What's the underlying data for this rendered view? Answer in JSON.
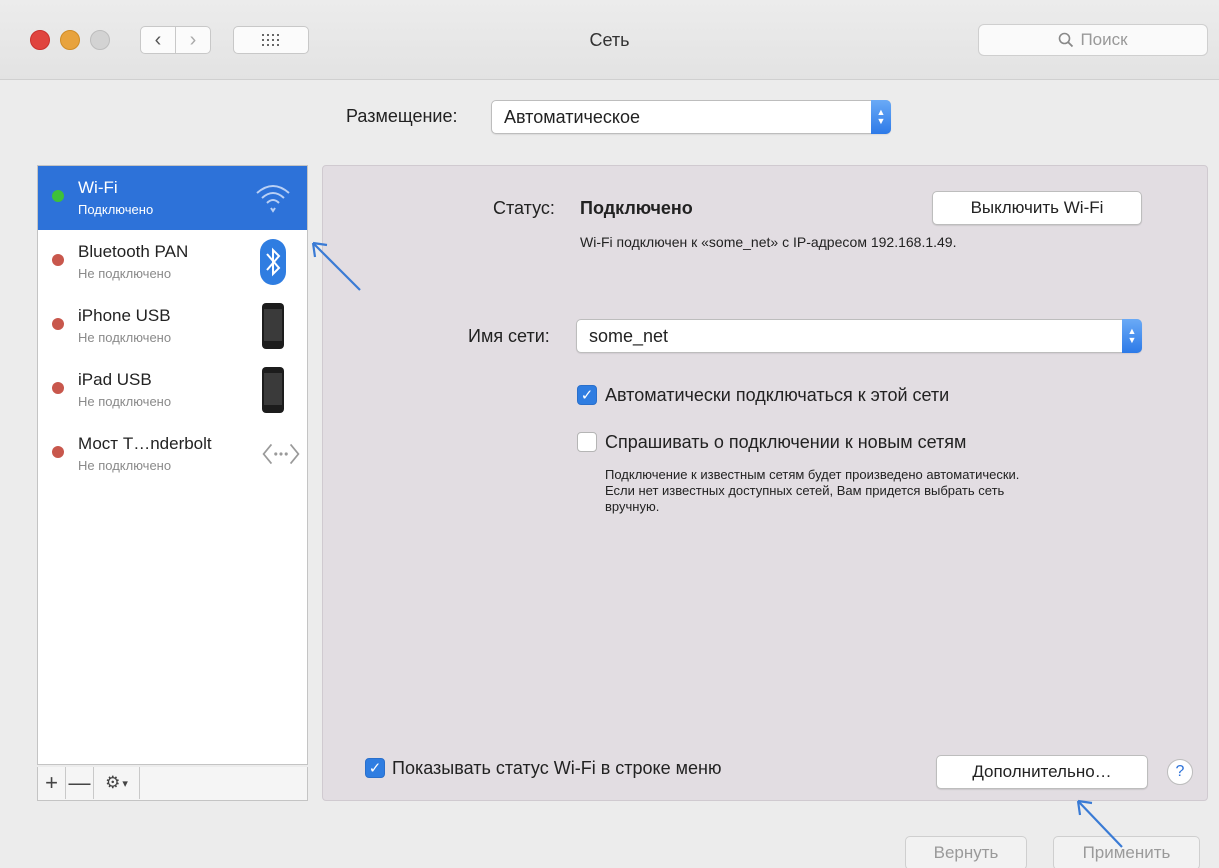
{
  "window": {
    "title": "Сеть"
  },
  "search": {
    "placeholder": "Поиск"
  },
  "location": {
    "label": "Размещение:",
    "value": "Автоматическое"
  },
  "services": [
    {
      "name": "Wi-Fi",
      "status": "Подключено",
      "state": "connected",
      "icon": "wifi-icon"
    },
    {
      "name": "Bluetooth PAN",
      "status": "Не подключено",
      "state": "disconnected",
      "icon": "bluetooth-icon"
    },
    {
      "name": "iPhone USB",
      "status": "Не подключено",
      "state": "disconnected",
      "icon": "iphone-icon"
    },
    {
      "name": "iPad USB",
      "status": "Не подключено",
      "state": "disconnected",
      "icon": "ipad-icon"
    },
    {
      "name": "Мост T…nderbolt",
      "status": "Не подключено",
      "state": "disconnected",
      "icon": "bridge-icon"
    }
  ],
  "sidebar_tools": {
    "add": "+",
    "remove": "—"
  },
  "status": {
    "label": "Статус:",
    "value": "Подключено",
    "detail": "Wi-Fi подключен к «some_net» с IP-адресом 192.168.1.49.",
    "toggle_button": "Выключить Wi-Fi"
  },
  "network": {
    "label": "Имя сети:",
    "value": "some_net"
  },
  "options": {
    "auto_join": {
      "label": "Автоматически подключаться к этой сети",
      "checked": true
    },
    "ask_join": {
      "label": "Спрашивать о подключении к новым сетям",
      "checked": false
    },
    "ask_join_note": "Подключение к известным сетям будет произведено автоматически. Если нет известных доступных сетей, Вам придется выбрать сеть вручную."
  },
  "show_status": {
    "label": "Показывать статус Wi-Fi в строке меню",
    "checked": true
  },
  "advanced_button": "Дополнительно…",
  "help_label": "?",
  "revert_button": "Вернуть",
  "apply_button": "Применить",
  "colors": {
    "selected": "#2d72d9",
    "connected": "#3ec03a",
    "disconnected": "#c8574c",
    "checkbox": "#2f7de1"
  }
}
